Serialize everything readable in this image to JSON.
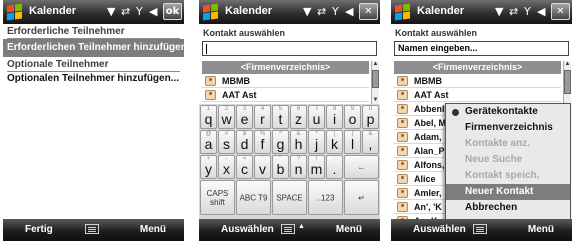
{
  "screen1": {
    "title": "Kalender",
    "ok_label": "ok",
    "required_section": "Erforderliche Teilnehmer",
    "required_add": "Erforderlichen Teilnehmer hinzufügen...",
    "optional_section": "Optionale Teilnehmer",
    "optional_add": "Optionalen Teilnehmer hinzufügen...",
    "softkey_left": "Fertig",
    "softkey_right": "Menü"
  },
  "screen2": {
    "title": "Kalender",
    "close_label": "✕",
    "subtitle": "Kontakt auswählen",
    "search_value": "",
    "list_header": "<Firmenverzeichnis>",
    "contacts": [
      "MBMB",
      "AAT Ast"
    ],
    "keyboard": {
      "row1": [
        {
          "k": "q",
          "s": "1"
        },
        {
          "k": "w",
          "s": "2"
        },
        {
          "k": "e",
          "s": "3"
        },
        {
          "k": "r",
          "s": "4"
        },
        {
          "k": "t",
          "s": "5"
        },
        {
          "k": "z",
          "s": "6"
        },
        {
          "k": "u",
          "s": "7"
        },
        {
          "k": "i",
          "s": "8"
        },
        {
          "k": "o",
          "s": "9"
        },
        {
          "k": "p",
          "s": "0"
        }
      ],
      "row2": [
        {
          "k": "a",
          "s": "@"
        },
        {
          "k": "s",
          "s": "#"
        },
        {
          "k": "d",
          "s": "$"
        },
        {
          "k": "f",
          "s": "%"
        },
        {
          "k": "g",
          "s": "^"
        },
        {
          "k": "h",
          "s": "&"
        },
        {
          "k": "j",
          "s": "*"
        },
        {
          "k": "k",
          "s": "("
        },
        {
          "k": "l",
          "s": ")"
        },
        {
          "k": ",",
          "s": "&"
        }
      ],
      "row3": [
        {
          "k": "y",
          "s": "+"
        },
        {
          "k": "x",
          "s": "-"
        },
        {
          "k": "c",
          "s": "="
        },
        {
          "k": "v",
          "s": "'"
        },
        {
          "k": "b",
          "s": "\""
        },
        {
          "k": "n",
          "s": "?"
        },
        {
          "k": "m",
          "s": "!"
        },
        {
          "k": ".",
          "s": ":"
        }
      ],
      "backspace": "←",
      "caps_shift": "CAPS\nshift",
      "abc_t9": "ABC T9",
      "space": "SPACE",
      "num": "..123",
      "enter": "↵"
    },
    "softkey_left": "Auswählen",
    "softkey_right": "Menü",
    "softkey_arrow": "▲"
  },
  "screen3": {
    "title": "Kalender",
    "close_label": "✕",
    "subtitle": "Kontakt auswählen",
    "search_value": "Namen eingeben...",
    "list_header": "<Firmenverzeichnis>",
    "contacts": [
      "MBMB",
      "AAT Ast",
      "Abbenl",
      "Abel, M",
      "Adam,",
      "Alan_P",
      "Alfons,",
      "Alice",
      "Amler,",
      "An', 'K",
      "An, Kw"
    ],
    "menu": [
      {
        "label": "Gerätekontakte",
        "state": "checked"
      },
      {
        "label": "Firmenverzeichnis",
        "state": "normal"
      },
      {
        "label": "Kontakte anz.",
        "state": "disabled"
      },
      {
        "label": "Neue Suche",
        "state": "disabled"
      },
      {
        "label": "Kontakt speich.",
        "state": "disabled"
      },
      {
        "label": "Neuer Kontakt",
        "state": "selected"
      },
      {
        "label": "Abbrechen",
        "state": "normal"
      }
    ],
    "softkey_left": "Auswählen",
    "softkey_right": "Menü"
  }
}
